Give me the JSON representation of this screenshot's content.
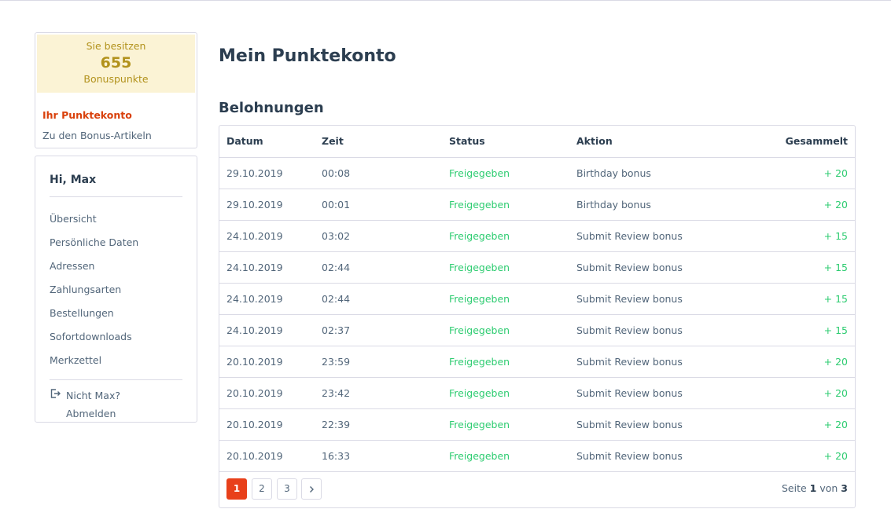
{
  "bonus": {
    "label_top": "Sie besitzen",
    "points": "655",
    "label_bottom": "Bonuspunkte",
    "links": [
      "Ihr Punktekonto",
      "Zu den Bonus-Artikeln"
    ]
  },
  "account": {
    "greeting": "Hi, Max",
    "nav": [
      "Übersicht",
      "Persönliche Daten",
      "Adressen",
      "Zahlungsarten",
      "Bestellungen",
      "Sofortdownloads",
      "Merkzettel"
    ],
    "logout_line1": "Nicht Max?",
    "logout_line2": "Abmelden",
    "logout_icon": "logout-icon"
  },
  "main": {
    "title": "Mein Punktekonto",
    "section": "Belohnungen"
  },
  "table": {
    "headers": [
      "Datum",
      "Zeit",
      "Status",
      "Aktion",
      "Gesammelt"
    ],
    "rows": [
      [
        "29.10.2019",
        "00:08",
        "Freigegeben",
        "Birthday bonus",
        "+ 20"
      ],
      [
        "29.10.2019",
        "00:01",
        "Freigegeben",
        "Birthday bonus",
        "+ 20"
      ],
      [
        "24.10.2019",
        "03:02",
        "Freigegeben",
        "Submit Review bonus",
        "+ 15"
      ],
      [
        "24.10.2019",
        "02:44",
        "Freigegeben",
        "Submit Review bonus",
        "+ 15"
      ],
      [
        "24.10.2019",
        "02:44",
        "Freigegeben",
        "Submit Review bonus",
        "+ 15"
      ],
      [
        "24.10.2019",
        "02:37",
        "Freigegeben",
        "Submit Review bonus",
        "+ 15"
      ],
      [
        "20.10.2019",
        "23:59",
        "Freigegeben",
        "Submit Review bonus",
        "+ 20"
      ],
      [
        "20.10.2019",
        "23:42",
        "Freigegeben",
        "Submit Review bonus",
        "+ 20"
      ],
      [
        "20.10.2019",
        "22:39",
        "Freigegeben",
        "Submit Review bonus",
        "+ 20"
      ],
      [
        "20.10.2019",
        "16:33",
        "Freigegeben",
        "Submit Review bonus",
        "+ 20"
      ]
    ]
  },
  "pagination": {
    "pages": [
      "1",
      "2",
      "3"
    ],
    "next_icon": "chevron-right-icon",
    "current": "1",
    "info_prefix": "Seite",
    "info_mid": "von",
    "total": "3"
  },
  "colors": {
    "accent": "#e8401a",
    "status_green": "#2ecc71",
    "bonus_bg": "#fbf3d5",
    "bonus_text": "#b2921c"
  }
}
